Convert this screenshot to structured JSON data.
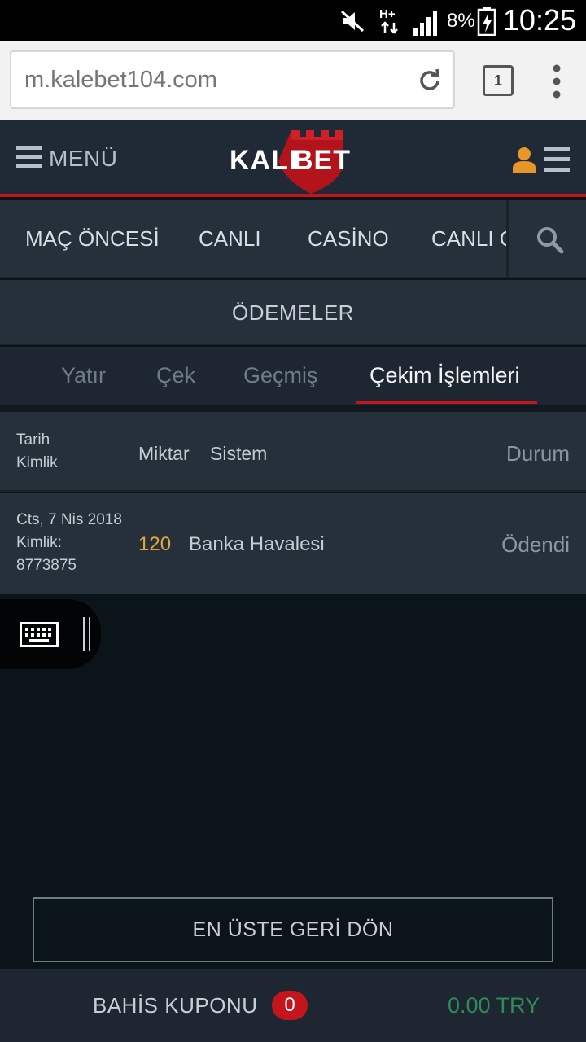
{
  "statusbar": {
    "battery_percent": "8%",
    "time": "10:25",
    "network_label": "H+"
  },
  "browser": {
    "url": "m.kalebet104.com",
    "tab_count": "1"
  },
  "header": {
    "menu_label": "MENÜ",
    "logo_part1": "KALE",
    "logo_part2": "BET"
  },
  "nav": {
    "items": [
      "MAÇ ÖNCESİ",
      "CANLI",
      "CASİNO",
      "CANLI C"
    ]
  },
  "section": {
    "title": "ÖDEMELER"
  },
  "subtabs": {
    "items": [
      "Yatır",
      "Çek",
      "Geçmiş",
      "Çekim İşlemleri"
    ],
    "active_index": 3
  },
  "table": {
    "headers": {
      "date": "Tarih",
      "id": "Kimlik",
      "amount": "Miktar",
      "system": "Sistem",
      "status": "Durum"
    },
    "rows": [
      {
        "date": "Cts, 7 Nis 2018",
        "id_label": "Kimlik:",
        "id": "8773875",
        "amount": "120",
        "system": "Banka Havalesi",
        "status": "Ödendi"
      }
    ]
  },
  "footer": {
    "back_to_top": "EN ÜSTE GERİ DÖN",
    "betslip_label": "BAHİS KUPONU",
    "betslip_count": "0",
    "balance": "0.00 TRY"
  },
  "colors": {
    "accent_red": "#c4151c",
    "header_bg": "#1f2a36",
    "panel_bg": "#26303b",
    "amount_orange": "#e3a63c",
    "balance_green": "#2f8b57"
  },
  "icons": [
    "mute-icon",
    "network-icon",
    "signal-icon",
    "battery-charging-icon",
    "reload-icon",
    "tabs-icon",
    "overflow-menu-icon",
    "hamburger-icon",
    "user-icon",
    "search-icon",
    "keyboard-icon"
  ]
}
